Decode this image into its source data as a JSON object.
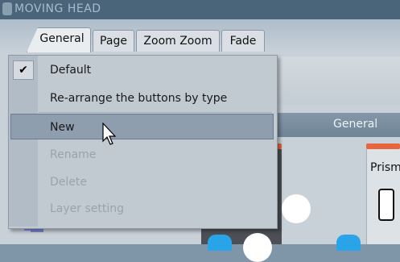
{
  "window": {
    "title": "MOVING HEAD"
  },
  "tabs": [
    {
      "label": "General",
      "active": true
    },
    {
      "label": "Page"
    },
    {
      "label": "Zoom Zoom"
    },
    {
      "label": "Fade"
    }
  ],
  "section_header": {
    "label": "General"
  },
  "right_panel": {
    "label": "Prism"
  },
  "menu": {
    "items": [
      {
        "label": "Default",
        "checked": true,
        "enabled": true
      },
      {
        "label": "Re-arrange the buttons by type",
        "enabled": true
      },
      {
        "label": "New",
        "enabled": true,
        "highlighted": true
      },
      {
        "label": "Rename",
        "enabled": false
      },
      {
        "label": "Delete",
        "enabled": false
      },
      {
        "label": "Layer setting",
        "enabled": false
      }
    ],
    "check_glyph": "✔"
  },
  "colors": {
    "accent_orange": "#e8643c",
    "highlight": "#8e9eae"
  }
}
